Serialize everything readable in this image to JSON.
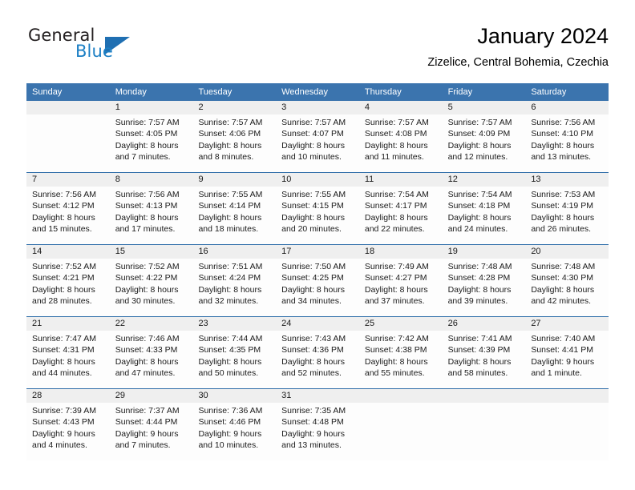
{
  "brand": {
    "word_one": "General",
    "word_two": "Blue",
    "triangle_color": "#1f6fb2",
    "blue_text_color": "#1c7fc4"
  },
  "header": {
    "title": "January 2024",
    "subtitle": "Zizelice, Central Bohemia, Czechia"
  },
  "theme": {
    "header_row_bg": "#3b74ae",
    "header_row_text": "#ffffff",
    "day_number_band_bg": "#efefef",
    "row_divider": "#2c6ca8",
    "cell_bg": "#fdfdfd"
  },
  "weekday_headers": [
    "Sunday",
    "Monday",
    "Tuesday",
    "Wednesday",
    "Thursday",
    "Friday",
    "Saturday"
  ],
  "labels": {
    "sunrise_prefix": "Sunrise:",
    "sunset_prefix": "Sunset:",
    "daylight_prefix": "Daylight:"
  },
  "weeks": [
    [
      {
        "day": "",
        "line1": "",
        "line2": "",
        "line3": "",
        "line4": "",
        "empty": true
      },
      {
        "day": "1",
        "line1": "Sunrise: 7:57 AM",
        "line2": "Sunset: 4:05 PM",
        "line3": "Daylight: 8 hours",
        "line4": "and 7 minutes.",
        "empty": false
      },
      {
        "day": "2",
        "line1": "Sunrise: 7:57 AM",
        "line2": "Sunset: 4:06 PM",
        "line3": "Daylight: 8 hours",
        "line4": "and 8 minutes.",
        "empty": false
      },
      {
        "day": "3",
        "line1": "Sunrise: 7:57 AM",
        "line2": "Sunset: 4:07 PM",
        "line3": "Daylight: 8 hours",
        "line4": "and 10 minutes.",
        "empty": false
      },
      {
        "day": "4",
        "line1": "Sunrise: 7:57 AM",
        "line2": "Sunset: 4:08 PM",
        "line3": "Daylight: 8 hours",
        "line4": "and 11 minutes.",
        "empty": false
      },
      {
        "day": "5",
        "line1": "Sunrise: 7:57 AM",
        "line2": "Sunset: 4:09 PM",
        "line3": "Daylight: 8 hours",
        "line4": "and 12 minutes.",
        "empty": false
      },
      {
        "day": "6",
        "line1": "Sunrise: 7:56 AM",
        "line2": "Sunset: 4:10 PM",
        "line3": "Daylight: 8 hours",
        "line4": "and 13 minutes.",
        "empty": false
      }
    ],
    [
      {
        "day": "7",
        "line1": "Sunrise: 7:56 AM",
        "line2": "Sunset: 4:12 PM",
        "line3": "Daylight: 8 hours",
        "line4": "and 15 minutes.",
        "empty": false
      },
      {
        "day": "8",
        "line1": "Sunrise: 7:56 AM",
        "line2": "Sunset: 4:13 PM",
        "line3": "Daylight: 8 hours",
        "line4": "and 17 minutes.",
        "empty": false
      },
      {
        "day": "9",
        "line1": "Sunrise: 7:55 AM",
        "line2": "Sunset: 4:14 PM",
        "line3": "Daylight: 8 hours",
        "line4": "and 18 minutes.",
        "empty": false
      },
      {
        "day": "10",
        "line1": "Sunrise: 7:55 AM",
        "line2": "Sunset: 4:15 PM",
        "line3": "Daylight: 8 hours",
        "line4": "and 20 minutes.",
        "empty": false
      },
      {
        "day": "11",
        "line1": "Sunrise: 7:54 AM",
        "line2": "Sunset: 4:17 PM",
        "line3": "Daylight: 8 hours",
        "line4": "and 22 minutes.",
        "empty": false
      },
      {
        "day": "12",
        "line1": "Sunrise: 7:54 AM",
        "line2": "Sunset: 4:18 PM",
        "line3": "Daylight: 8 hours",
        "line4": "and 24 minutes.",
        "empty": false
      },
      {
        "day": "13",
        "line1": "Sunrise: 7:53 AM",
        "line2": "Sunset: 4:19 PM",
        "line3": "Daylight: 8 hours",
        "line4": "and 26 minutes.",
        "empty": false
      }
    ],
    [
      {
        "day": "14",
        "line1": "Sunrise: 7:52 AM",
        "line2": "Sunset: 4:21 PM",
        "line3": "Daylight: 8 hours",
        "line4": "and 28 minutes.",
        "empty": false
      },
      {
        "day": "15",
        "line1": "Sunrise: 7:52 AM",
        "line2": "Sunset: 4:22 PM",
        "line3": "Daylight: 8 hours",
        "line4": "and 30 minutes.",
        "empty": false
      },
      {
        "day": "16",
        "line1": "Sunrise: 7:51 AM",
        "line2": "Sunset: 4:24 PM",
        "line3": "Daylight: 8 hours",
        "line4": "and 32 minutes.",
        "empty": false
      },
      {
        "day": "17",
        "line1": "Sunrise: 7:50 AM",
        "line2": "Sunset: 4:25 PM",
        "line3": "Daylight: 8 hours",
        "line4": "and 34 minutes.",
        "empty": false
      },
      {
        "day": "18",
        "line1": "Sunrise: 7:49 AM",
        "line2": "Sunset: 4:27 PM",
        "line3": "Daylight: 8 hours",
        "line4": "and 37 minutes.",
        "empty": false
      },
      {
        "day": "19",
        "line1": "Sunrise: 7:48 AM",
        "line2": "Sunset: 4:28 PM",
        "line3": "Daylight: 8 hours",
        "line4": "and 39 minutes.",
        "empty": false
      },
      {
        "day": "20",
        "line1": "Sunrise: 7:48 AM",
        "line2": "Sunset: 4:30 PM",
        "line3": "Daylight: 8 hours",
        "line4": "and 42 minutes.",
        "empty": false
      }
    ],
    [
      {
        "day": "21",
        "line1": "Sunrise: 7:47 AM",
        "line2": "Sunset: 4:31 PM",
        "line3": "Daylight: 8 hours",
        "line4": "and 44 minutes.",
        "empty": false
      },
      {
        "day": "22",
        "line1": "Sunrise: 7:46 AM",
        "line2": "Sunset: 4:33 PM",
        "line3": "Daylight: 8 hours",
        "line4": "and 47 minutes.",
        "empty": false
      },
      {
        "day": "23",
        "line1": "Sunrise: 7:44 AM",
        "line2": "Sunset: 4:35 PM",
        "line3": "Daylight: 8 hours",
        "line4": "and 50 minutes.",
        "empty": false
      },
      {
        "day": "24",
        "line1": "Sunrise: 7:43 AM",
        "line2": "Sunset: 4:36 PM",
        "line3": "Daylight: 8 hours",
        "line4": "and 52 minutes.",
        "empty": false
      },
      {
        "day": "25",
        "line1": "Sunrise: 7:42 AM",
        "line2": "Sunset: 4:38 PM",
        "line3": "Daylight: 8 hours",
        "line4": "and 55 minutes.",
        "empty": false
      },
      {
        "day": "26",
        "line1": "Sunrise: 7:41 AM",
        "line2": "Sunset: 4:39 PM",
        "line3": "Daylight: 8 hours",
        "line4": "and 58 minutes.",
        "empty": false
      },
      {
        "day": "27",
        "line1": "Sunrise: 7:40 AM",
        "line2": "Sunset: 4:41 PM",
        "line3": "Daylight: 9 hours",
        "line4": "and 1 minute.",
        "empty": false
      }
    ],
    [
      {
        "day": "28",
        "line1": "Sunrise: 7:39 AM",
        "line2": "Sunset: 4:43 PM",
        "line3": "Daylight: 9 hours",
        "line4": "and 4 minutes.",
        "empty": false
      },
      {
        "day": "29",
        "line1": "Sunrise: 7:37 AM",
        "line2": "Sunset: 4:44 PM",
        "line3": "Daylight: 9 hours",
        "line4": "and 7 minutes.",
        "empty": false
      },
      {
        "day": "30",
        "line1": "Sunrise: 7:36 AM",
        "line2": "Sunset: 4:46 PM",
        "line3": "Daylight: 9 hours",
        "line4": "and 10 minutes.",
        "empty": false
      },
      {
        "day": "31",
        "line1": "Sunrise: 7:35 AM",
        "line2": "Sunset: 4:48 PM",
        "line3": "Daylight: 9 hours",
        "line4": "and 13 minutes.",
        "empty": false
      },
      {
        "day": "",
        "line1": "",
        "line2": "",
        "line3": "",
        "line4": "",
        "empty": true
      },
      {
        "day": "",
        "line1": "",
        "line2": "",
        "line3": "",
        "line4": "",
        "empty": true
      },
      {
        "day": "",
        "line1": "",
        "line2": "",
        "line3": "",
        "line4": "",
        "empty": true
      }
    ]
  ]
}
